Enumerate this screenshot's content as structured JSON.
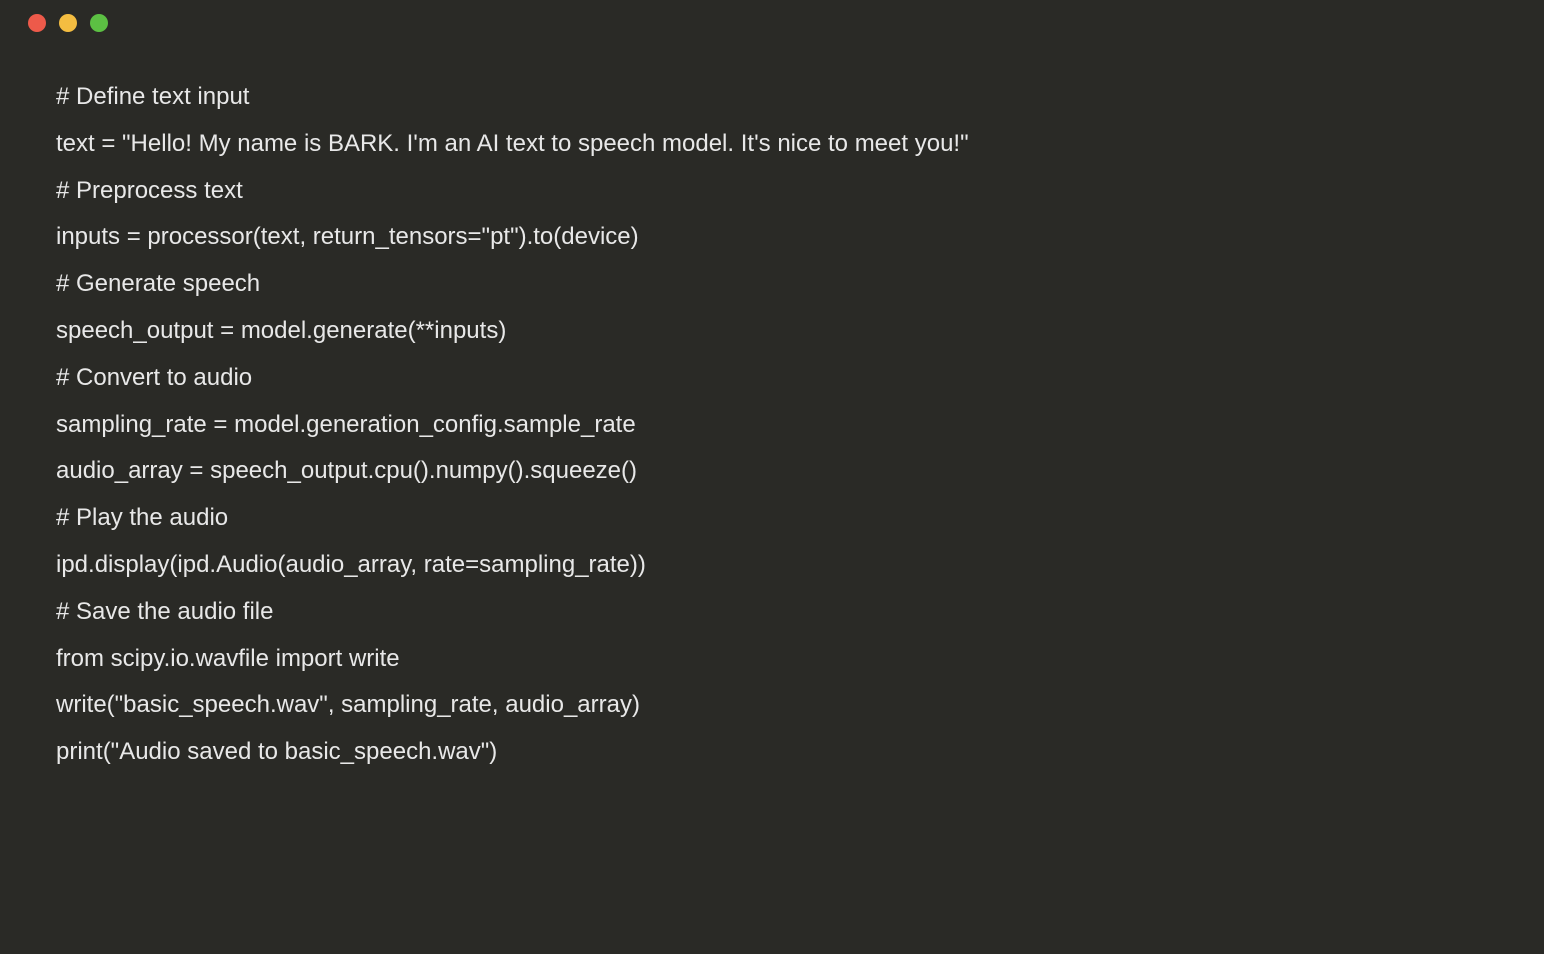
{
  "window": {
    "controls": {
      "close_color": "#ed5a4a",
      "minimize_color": "#f4bd41",
      "maximize_color": "#5cc043"
    }
  },
  "code": {
    "lines": [
      "# Define text input",
      "text = \"Hello! My name is BARK. I'm an AI text to speech model. It's nice to meet you!\"",
      "# Preprocess text",
      "inputs = processor(text, return_tensors=\"pt\").to(device)",
      "# Generate speech",
      "speech_output = model.generate(**inputs)",
      "# Convert to audio",
      "sampling_rate = model.generation_config.sample_rate",
      "audio_array = speech_output.cpu().numpy().squeeze()",
      "# Play the audio",
      "ipd.display(ipd.Audio(audio_array, rate=sampling_rate))",
      "# Save the audio file",
      "from scipy.io.wavfile import write",
      "write(\"basic_speech.wav\", sampling_rate, audio_array)",
      "print(\"Audio saved to basic_speech.wav\")"
    ]
  }
}
